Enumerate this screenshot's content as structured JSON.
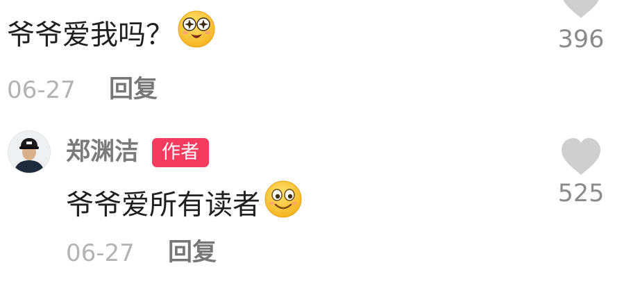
{
  "comments": [
    {
      "text": "爷爷爱我吗？",
      "emoji": "starry-eyed-emoji",
      "date": "06-27",
      "reply_label": "回复",
      "likes": "396",
      "like_icon": "heart-icon"
    },
    {
      "author": "郑渊洁",
      "author_tag": "作者",
      "avatar": "avatar-icon",
      "text": "爷爷爱所有读者",
      "emoji": "smiling-face-emoji",
      "date": "06-27",
      "reply_label": "回复",
      "likes": "525",
      "like_icon": "heart-icon"
    }
  ],
  "colors": {
    "tag_bg": "#f33a5f",
    "heart": "#cfcfcf",
    "muted_text": "#b3b3b3"
  }
}
